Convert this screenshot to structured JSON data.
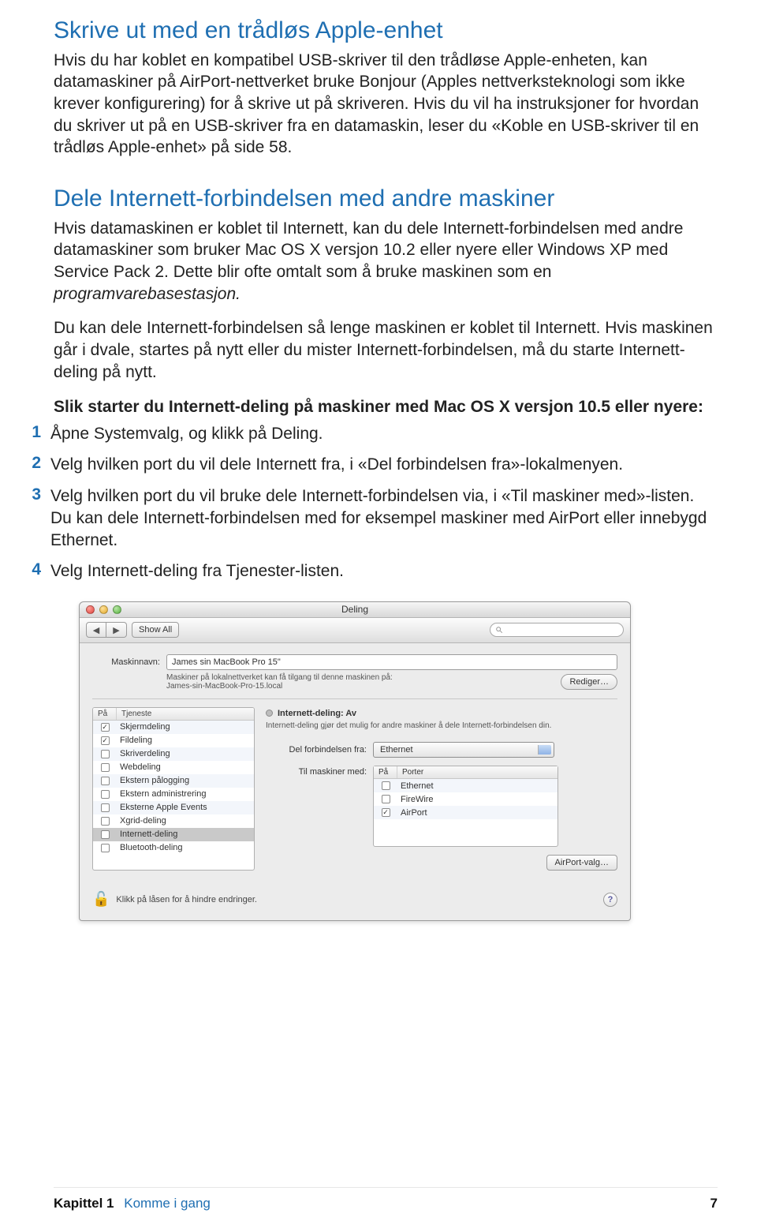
{
  "section1": {
    "title": "Skrive ut med en trådløs Apple-enhet",
    "p1": "Hvis du har koblet en kompatibel USB-skriver til den trådløse Apple-enheten, kan datamaskiner på AirPort-nettverket bruke Bonjour (Apples nettverksteknologi som ikke krever konfigurering) for å skrive ut på skriveren. Hvis du vil ha instruksjoner for hvordan du skriver ut på en USB-skriver fra en datamaskin, leser du «Koble en USB-skriver til en trådløs Apple-enhet» på side 58."
  },
  "section2": {
    "title": "Dele Internett-forbindelsen med andre maskiner",
    "p1a": "Hvis datamaskinen er koblet til Internett, kan du dele Internett-forbindelsen med andre datamaskiner som bruker Mac OS X versjon 10.2 eller nyere eller Windows XP med Service Pack 2. Dette blir ofte omtalt som å bruke maskinen som en ",
    "p1b_italic": "programvarebasestasjon.",
    "p2": "Du kan dele Internett-forbindelsen så lenge maskinen er koblet til Internett. Hvis maskinen går i dvale, startes på nytt eller du mister Internett-forbindelsen, må du starte Internett-deling på nytt.",
    "steps_head": "Slik starter du Internett-deling på maskiner med Mac OS X versjon 10.5 eller nyere:",
    "steps": [
      "Åpne Systemvalg, og klikk på Deling.",
      "Velg hvilken port du vil dele Internett fra, i «Del forbindelsen fra»-lokalmenyen.",
      "Velg hvilken port du vil bruke dele Internett-forbindelsen via, i «Til maskiner med»-listen. Du kan dele Internett-forbindelsen med for eksempel maskiner med AirPort eller innebygd Ethernet.",
      "Velg Internett-deling fra Tjenester-listen."
    ]
  },
  "mac": {
    "window_title": "Deling",
    "toolbar": {
      "back": "◀",
      "fwd": "▶",
      "showall": "Show All"
    },
    "computer_name_label": "Maskinnavn:",
    "computer_name_value": "James sin MacBook Pro 15\"",
    "local_hint1": "Maskiner på lokalnettverket kan få tilgang til denne maskinen på:",
    "local_hint2": "James-sin-MacBook-Pro-15.local",
    "edit_btn": "Rediger…",
    "services_hdr_on": "På",
    "services_hdr_name": "Tjeneste",
    "services": [
      {
        "on": true,
        "name": "Skjermdeling"
      },
      {
        "on": true,
        "name": "Fildeling"
      },
      {
        "on": false,
        "name": "Skriverdeling"
      },
      {
        "on": false,
        "name": "Webdeling"
      },
      {
        "on": false,
        "name": "Ekstern pålogging"
      },
      {
        "on": false,
        "name": "Ekstern administrering"
      },
      {
        "on": false,
        "name": "Eksterne Apple Events"
      },
      {
        "on": false,
        "name": "Xgrid-deling"
      },
      {
        "on": false,
        "name": "Internett-deling",
        "selected": true
      },
      {
        "on": false,
        "name": "Bluetooth-deling"
      }
    ],
    "status_title": "Internett-deling: Av",
    "status_desc": "Internett-deling gjør det mulig for andre maskiner å dele Internett-forbindelsen din.",
    "share_from_label": "Del forbindelsen fra:",
    "share_from_value": "Ethernet",
    "to_computers_label": "Til maskiner med:",
    "ports_hdr_on": "På",
    "ports_hdr_name": "Porter",
    "ports": [
      {
        "on": false,
        "name": "Ethernet"
      },
      {
        "on": false,
        "name": "FireWire"
      },
      {
        "on": true,
        "name": "AirPort"
      }
    ],
    "airport_opts_btn": "AirPort-valg…",
    "lock_text": "Klikk på låsen for å hindre endringer."
  },
  "footer": {
    "chapter": "Kapittel 1",
    "chapter_name": "Komme i gang",
    "page": "7"
  }
}
